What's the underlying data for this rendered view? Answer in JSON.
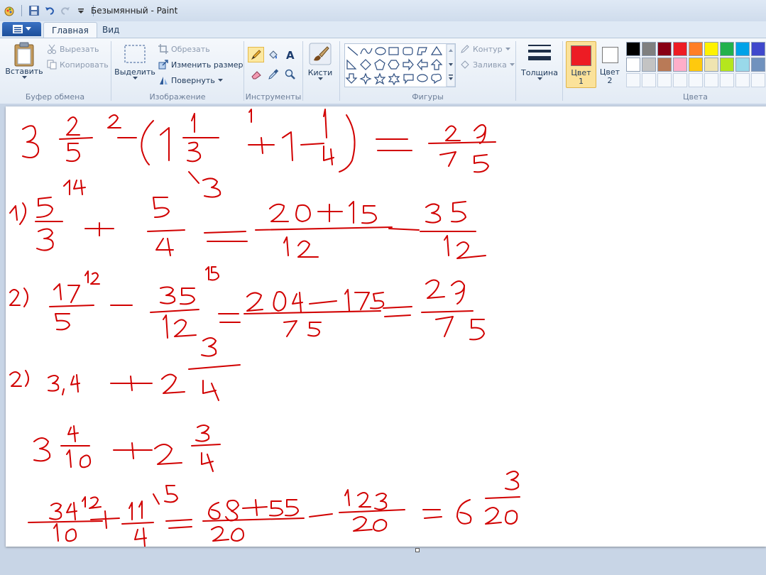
{
  "window": {
    "title": "Безымянный - Paint"
  },
  "tabs": [
    {
      "label": "Главная",
      "active": true
    },
    {
      "label": "Вид",
      "active": false
    }
  ],
  "clipboard": {
    "paste_label": "Вставить",
    "cut_label": "Вырезать",
    "copy_label": "Копировать",
    "group_label": "Буфер обмена"
  },
  "image": {
    "select_label": "Выделить",
    "crop_label": "Обрезать",
    "resize_label": "Изменить размер",
    "rotate_label": "Повернуть",
    "group_label": "Изображение"
  },
  "tools": {
    "group_label": "Инструменты",
    "selected": "pencil"
  },
  "brushes": {
    "label": "Кисти"
  },
  "shapes": {
    "outline_label": "Контур",
    "fill_label": "Заливка",
    "group_label": "Фигуры"
  },
  "thickness": {
    "label": "Толщина"
  },
  "colors": {
    "color1_label": "Цвет",
    "color1_num": "1",
    "color1": "#ed1c24",
    "color2_label": "Цвет",
    "color2_num": "2",
    "color2": "#ffffff",
    "group_label": "Цвета",
    "palette_row1": [
      "#000000",
      "#7f7f7f",
      "#880015",
      "#ed1c24",
      "#ff7f27",
      "#fff200",
      "#22b14c",
      "#00a2e8",
      "#3f48cc"
    ],
    "palette_row2": [
      "#ffffff",
      "#c3c3c3",
      "#b97a57",
      "#ffaec9",
      "#ffc90e",
      "#efe4b0",
      "#b5e61d",
      "#99d9ea",
      "#7092be"
    ]
  },
  "drawing": {
    "ink_color": "#d10000",
    "lines": [
      "3 2/5 ^2 − (1 1/3 ^1 + 1 1/4) = 29/75",
      "1) 5/3 ^14 + 5/4 ^13 = (20+15)/12 = 35/12",
      "2) 17/5 ^12 − 35/12 ^15 = (204−175)/75 = 29/75",
      "2) 3,4 + 2 3/4",
      "3 4/10 + 2 3/4",
      "34/10 ^12 + 11/4 ^15 = (68+55)/20 = 123/20 = 6 3/20"
    ]
  }
}
